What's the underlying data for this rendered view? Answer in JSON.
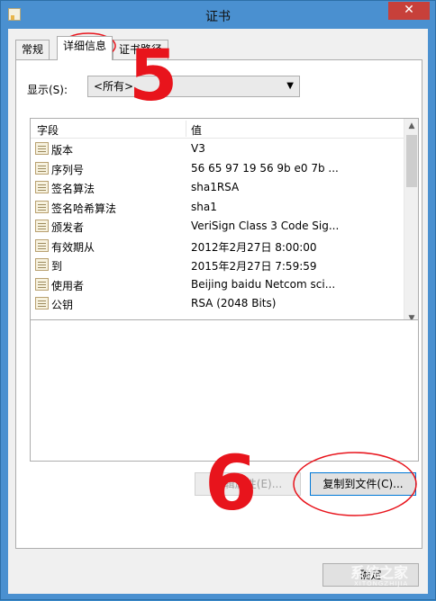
{
  "window": {
    "title": "证书",
    "close_glyph": "✕"
  },
  "tabs": [
    {
      "label": "常规"
    },
    {
      "label": "详细信息"
    },
    {
      "label": "证书路径"
    }
  ],
  "show": {
    "label": "显示(S):",
    "selected": "<所有>"
  },
  "list": {
    "header_field": "字段",
    "header_value": "值",
    "rows": [
      {
        "field": "版本",
        "value": "V3"
      },
      {
        "field": "序列号",
        "value": "56 65 97 19 56 9b e0 7b ..."
      },
      {
        "field": "签名算法",
        "value": "sha1RSA"
      },
      {
        "field": "签名哈希算法",
        "value": "sha1"
      },
      {
        "field": "颁发者",
        "value": "VeriSign Class 3 Code Sig..."
      },
      {
        "field": "有效期从",
        "value": "2012年2月27日 8:00:00"
      },
      {
        "field": "到",
        "value": "2015年2月27日 7:59:59"
      },
      {
        "field": "使用者",
        "value": "Beijing baidu Netcom sci..."
      },
      {
        "field": "公钥",
        "value": "RSA (2048 Bits)"
      }
    ]
  },
  "buttons": {
    "edit_properties": "编辑属性(E)...",
    "copy_to_file": "复制到文件(C)...",
    "ok": "确定"
  },
  "annotations": {
    "step1": "5",
    "step2": "6",
    "color": "#e8141c"
  },
  "watermark": {
    "text": "系统之家",
    "sub": "XITONGZHIJIA"
  }
}
